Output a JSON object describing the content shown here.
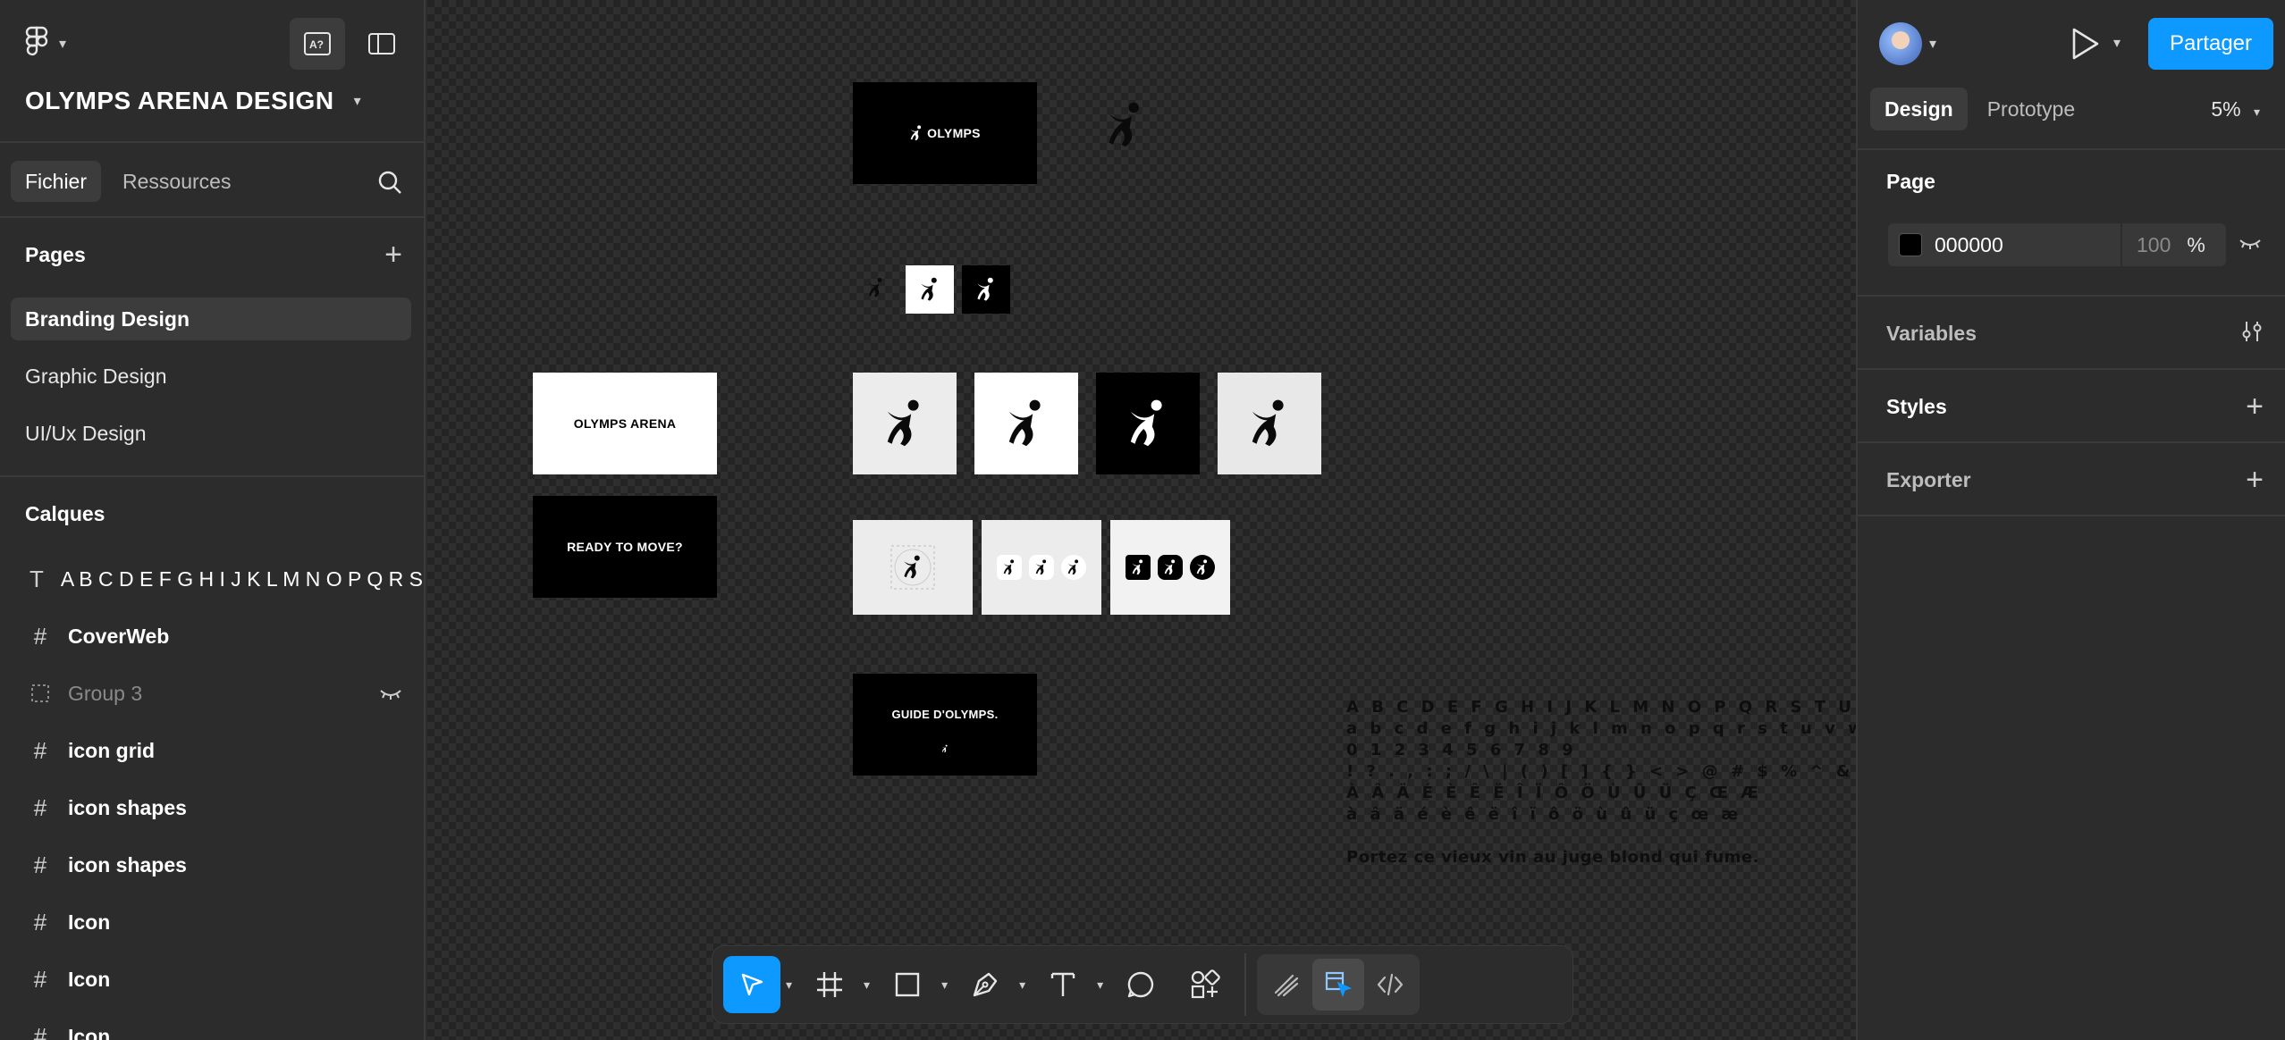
{
  "project": {
    "title": "OLYMPS ARENA DESIGN"
  },
  "left_tabs": [
    {
      "label": "Fichier"
    },
    {
      "label": "Ressources"
    }
  ],
  "pages": {
    "title": "Pages",
    "items": [
      {
        "label": "Branding Design"
      },
      {
        "label": "Graphic Design"
      },
      {
        "label": "UI/Ux Design"
      }
    ]
  },
  "layers": {
    "title": "Calques",
    "items": [
      {
        "icon": "text-icon",
        "label": "A B C D E F G H I J K L M N O P Q R S T U V W X Y Z",
        "bold": false
      },
      {
        "icon": "frame-icon",
        "label": "CoverWeb",
        "bold": true
      },
      {
        "icon": "group-icon",
        "label": "Group 3",
        "bold": false,
        "hidden": true
      },
      {
        "icon": "frame-icon",
        "label": "icon grid",
        "bold": true
      },
      {
        "icon": "frame-icon",
        "label": "icon shapes",
        "bold": true
      },
      {
        "icon": "frame-icon",
        "label": "icon shapes",
        "bold": true
      },
      {
        "icon": "frame-icon",
        "label": "Icon",
        "bold": true
      },
      {
        "icon": "frame-icon",
        "label": "Icon",
        "bold": true
      },
      {
        "icon": "frame-icon",
        "label": "Icon",
        "bold": true
      }
    ]
  },
  "canvas": {
    "logo_banner_text": "OLYMPS",
    "arena_banner_text": "OLYMPS ARENA",
    "ready_banner_text": "READY TO MOVE?",
    "guide_banner_text": "GUIDE D'OLYMPS.",
    "font_specimen": {
      "uppercase": "A B C D E F G H I J K L M N O P Q R S T U V W X Y Z",
      "lowercase": "a b c d e f g h i j k l m n o p q r s t u v w x y z",
      "digits": "0 1 2 3 4 5 6 7 8 9",
      "symbols": "! ? . , : ; / \\ | ( ) [ ] { } < > @ # $ % ^ & * _ - + = ~ \" ' `",
      "accents_upper": "À Â Ä É È Ê Ë Î Ï Ô Ö Ù Û Ü Ç Œ Æ",
      "accents_lower": "à â ä é è ê ë î ï ô ö ù û ü ç œ æ",
      "pangram": "Portez ce vieux vin au juge blond qui fume."
    }
  },
  "right": {
    "share_label": "Partager",
    "tabs": [
      {
        "label": "Design"
      },
      {
        "label": "Prototype"
      }
    ],
    "zoom": "5%",
    "page_section": "Page",
    "page_color": "000000",
    "page_opacity": "100",
    "opacity_unit": "%",
    "variables": "Variables",
    "styles": "Styles",
    "exporter": "Exporter"
  },
  "help_label": "?",
  "colors": {
    "accent": "#0d99ff",
    "panel": "#2c2c2c",
    "canvas": "#242424"
  }
}
